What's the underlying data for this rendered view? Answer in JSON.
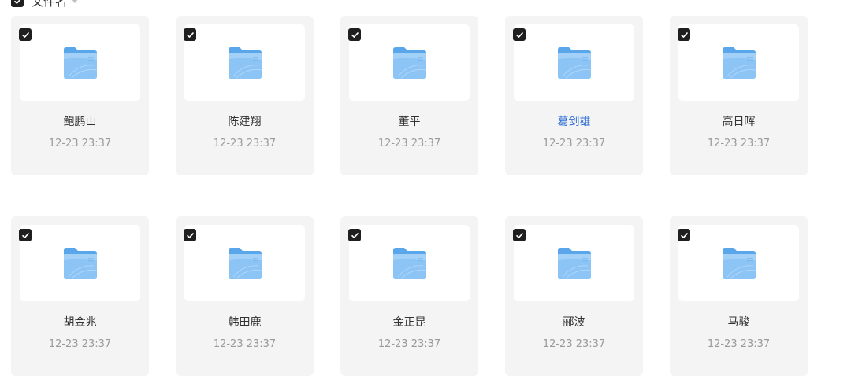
{
  "header": {
    "label": "文件名"
  },
  "colors": {
    "accent_link": "#2f6fd6",
    "folder_main": "#8cc4f6",
    "folder_tab": "#5aa6ea",
    "card_bg": "#f4f4f4"
  },
  "icons": {
    "checkbox": "checkmark-icon",
    "folder": "folder-icon",
    "sort": "caret-down-icon"
  },
  "folders": [
    {
      "name": "鲍鹏山",
      "date": "12-23 23:37"
    },
    {
      "name": "陈建翔",
      "date": "12-23 23:37"
    },
    {
      "name": "董平",
      "date": "12-23 23:37"
    },
    {
      "name": "葛剑雄",
      "date": "12-23 23:37"
    },
    {
      "name": "高日晖",
      "date": "12-23 23:37"
    },
    {
      "name": "胡金兆",
      "date": "12-23 23:37"
    },
    {
      "name": "韩田鹿",
      "date": "12-23 23:37"
    },
    {
      "name": "金正昆",
      "date": "12-23 23:37"
    },
    {
      "name": "郦波",
      "date": "12-23 23:37"
    },
    {
      "name": "马骏",
      "date": "12-23 23:37"
    }
  ]
}
